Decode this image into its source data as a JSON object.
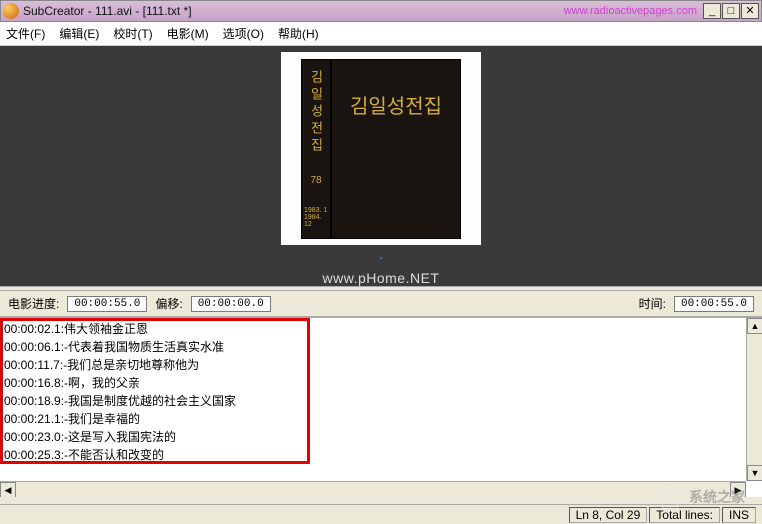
{
  "titlebar": {
    "app": "SubCreator",
    "file1": "111.avi",
    "file2": "[111.txt *]",
    "url": "www.radioactivepages.com"
  },
  "menu": {
    "file": "文件(F)",
    "edit": "编辑(E)",
    "timing": "校时(T)",
    "movie": "电影(M)",
    "options": "选项(O)",
    "help": "帮助(H)"
  },
  "video": {
    "spine_text": "김일성전집",
    "spine_number": "78",
    "spine_bottom": "1983. 1\n1984. 12",
    "cover_text": "김일성전집",
    "cue": "-",
    "watermark": "www.pHome.NET"
  },
  "status": {
    "progress_label": "电影进度:",
    "total_a": "00:00:55.0",
    "offset_label": "偏移:",
    "offset": "00:00:00.0",
    "time_label": "时间:",
    "total_b": "00:00:55.0"
  },
  "subs": [
    {
      "t": "00:00:02.1",
      "text": ":伟大领袖金正恩"
    },
    {
      "t": "00:00:06.1",
      "text": ":-代表着我国物质生活真实水准"
    },
    {
      "t": "00:00:11.7",
      "text": ":-我们总是亲切地尊称他为"
    },
    {
      "t": "00:00:16.8",
      "text": ":-啊，我的父亲"
    },
    {
      "t": "00:00:18.9",
      "text": ":-我国是制度优越的社会主义国家"
    },
    {
      "t": "00:00:21.1",
      "text": ":-我们是幸福的"
    },
    {
      "t": "00:00:23.0",
      "text": ":-这是写入我国宪法的"
    },
    {
      "t": "00:00:25.3",
      "text": ":-不能否认和改变的"
    }
  ],
  "bottom": {
    "pos": "Ln 8, Col 29",
    "lines": "Total lines:",
    "mode": "INS"
  },
  "corner_wm": "系统之家"
}
